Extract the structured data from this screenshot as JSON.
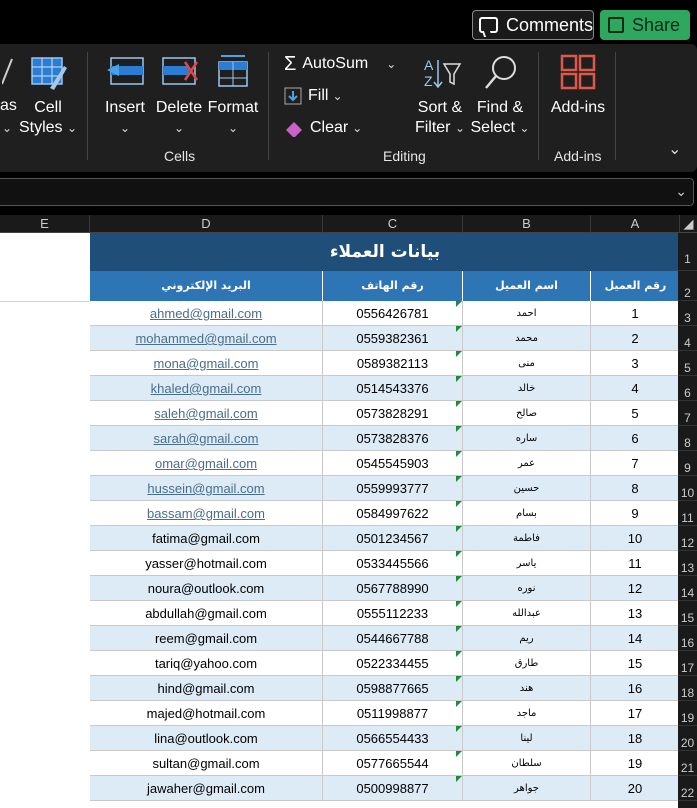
{
  "top": {
    "comments": "Comments",
    "share": "Share"
  },
  "ribbon": {
    "partial_left": "as",
    "cell_styles": [
      "Cell",
      "Styles"
    ],
    "insert": "Insert",
    "delete": "Delete",
    "format": "Format",
    "cells_group": "Cells",
    "autosum": "AutoSum",
    "fill": "Fill",
    "clear": "Clear",
    "sort_filter": [
      "Sort &",
      "Filter"
    ],
    "find_select": [
      "Find &",
      "Select"
    ],
    "editing_group": "Editing",
    "addins": "Add-ins",
    "addins_group": "Add-ins"
  },
  "columns": [
    "E",
    "D",
    "C",
    "B",
    "A"
  ],
  "row_numbers": [
    "1",
    "2",
    "3",
    "4",
    "5",
    "6",
    "7",
    "8",
    "9",
    "10",
    "11",
    "12",
    "13",
    "14",
    "15",
    "16",
    "17",
    "18",
    "19",
    "20",
    "21",
    "22"
  ],
  "table": {
    "title": "بيانات العملاء",
    "headers": {
      "email": "البريد الإلكتروني",
      "phone": "رقم الهاتف",
      "name": "اسم العميل",
      "id": "رقم العميل"
    },
    "rows": [
      {
        "id": "1",
        "name": "احمد",
        "phone": "0556426781",
        "email": "ahmed@gmail.com",
        "link": true
      },
      {
        "id": "2",
        "name": "محمد",
        "phone": "0559382361",
        "email": "mohammed@gmail.com",
        "link": true
      },
      {
        "id": "3",
        "name": "منى",
        "phone": "0589382113",
        "email": "mona@gmail.com",
        "link": true
      },
      {
        "id": "4",
        "name": "خالد",
        "phone": "0514543376",
        "email": "khaled@gmail.com",
        "link": true
      },
      {
        "id": "5",
        "name": "صالح",
        "phone": "0573828291",
        "email": "saleh@gmail.com",
        "link": true
      },
      {
        "id": "6",
        "name": "ساره",
        "phone": "0573828376",
        "email": "sarah@gmail.com",
        "link": true
      },
      {
        "id": "7",
        "name": "عمر",
        "phone": "0545545903",
        "email": "omar@gmail.com",
        "link": true
      },
      {
        "id": "8",
        "name": "حسين",
        "phone": "0559993777",
        "email": "hussein@gmail.com",
        "link": true
      },
      {
        "id": "9",
        "name": "بسام",
        "phone": "0584997622",
        "email": "bassam@gmail.com",
        "link": true
      },
      {
        "id": "10",
        "name": "فاطمة",
        "phone": "0501234567",
        "email": "fatima@gmail.com",
        "link": false
      },
      {
        "id": "11",
        "name": "ياسر",
        "phone": "0533445566",
        "email": "yasser@hotmail.com",
        "link": false
      },
      {
        "id": "12",
        "name": "نوره",
        "phone": "0567788990",
        "email": "noura@outlook.com",
        "link": false
      },
      {
        "id": "13",
        "name": "عبدالله",
        "phone": "0555112233",
        "email": "abdullah@gmail.com",
        "link": false
      },
      {
        "id": "14",
        "name": "ريم",
        "phone": "0544667788",
        "email": "reem@gmail.com",
        "link": false
      },
      {
        "id": "15",
        "name": "طارق",
        "phone": "0522334455",
        "email": "tariq@yahoo.com",
        "link": false
      },
      {
        "id": "16",
        "name": "هند",
        "phone": "0598877665",
        "email": "hind@gmail.com",
        "link": false
      },
      {
        "id": "17",
        "name": "ماجد",
        "phone": "0511998877",
        "email": "majed@hotmail.com",
        "link": false
      },
      {
        "id": "18",
        "name": "لينا",
        "phone": "0566554433",
        "email": "lina@outlook.com",
        "link": false
      },
      {
        "id": "19",
        "name": "سلطان",
        "phone": "0577665544",
        "email": "sultan@gmail.com",
        "link": false
      },
      {
        "id": "20",
        "name": "جواهر",
        "phone": "0500998877",
        "email": "jawaher@gmail.com",
        "link": false
      }
    ]
  },
  "colors": {
    "title_bg": "#1f4e79",
    "header_bg": "#2e75b6",
    "row_alt": "#ddebf7",
    "share_bg": "#2fa85f"
  }
}
